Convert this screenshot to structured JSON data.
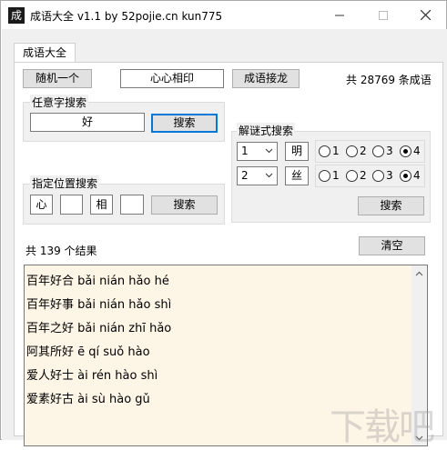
{
  "window": {
    "title": "成语大全 v1.1 by 52pojie.cn kun775",
    "icon_char": "成"
  },
  "tab": {
    "label": "成语大全"
  },
  "top": {
    "random_button": "随机一个",
    "current_idiom": "心心相印",
    "chain_button": "成语接龙",
    "count_text": "共 28769 条成语"
  },
  "any_search": {
    "group_label": "任意字搜索",
    "input_value": "好",
    "search_button": "搜索"
  },
  "position_search": {
    "group_label": "指定位置搜索",
    "chars": [
      "心",
      "",
      "相",
      ""
    ],
    "search_button": "搜索"
  },
  "riddle_search": {
    "group_label": "解谜式搜索",
    "rows": [
      {
        "combo_value": "1",
        "char": "明",
        "options": [
          "1",
          "2",
          "3",
          "4"
        ],
        "selected": "4"
      },
      {
        "combo_value": "2",
        "char": "丝",
        "options": [
          "1",
          "2",
          "3",
          "4"
        ],
        "selected": "4"
      }
    ],
    "search_button": "搜索"
  },
  "results": {
    "summary": "共 139 个结果",
    "clear_button": "清空",
    "lines": [
      "百年好合 bǎi nián hǎo hé",
      "百年好事 bǎi nián hǎo shì",
      "百年之好 bǎi nián zhī hǎo",
      "阿其所好 ē qí suǒ hào",
      "爱人好士 ài rén hào shì",
      "爱素好古 ài sù hào gǔ"
    ]
  },
  "watermark": "下载吧"
}
